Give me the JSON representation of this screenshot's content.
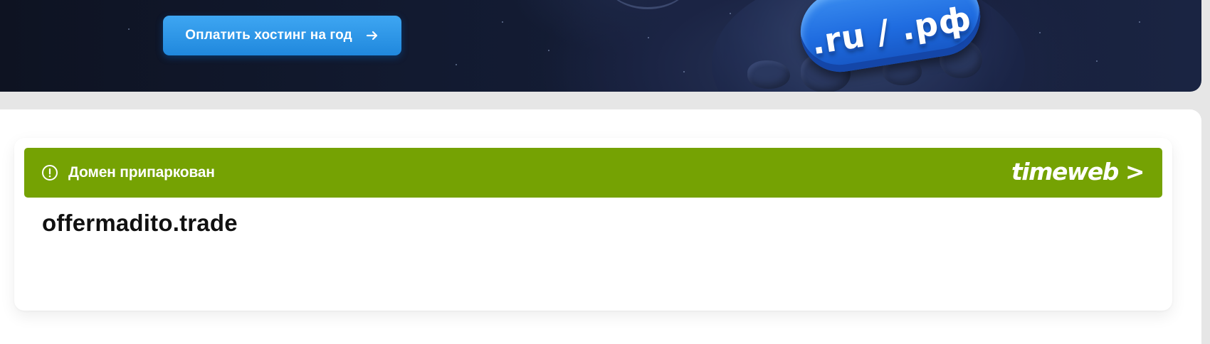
{
  "banner": {
    "pay_button_label": "Оплатить хостинг на год",
    "promo_badge_text": ".ru / .рф",
    "accent_color": "#2a93e8"
  },
  "parked": {
    "status_text": "Домен припаркован",
    "status_color": "#75a203",
    "brand_logo": "timeweb >",
    "domain": "offermadito.trade"
  },
  "icons": {
    "button_arrow": "arrow-right-icon",
    "status": "info-circle-icon"
  }
}
